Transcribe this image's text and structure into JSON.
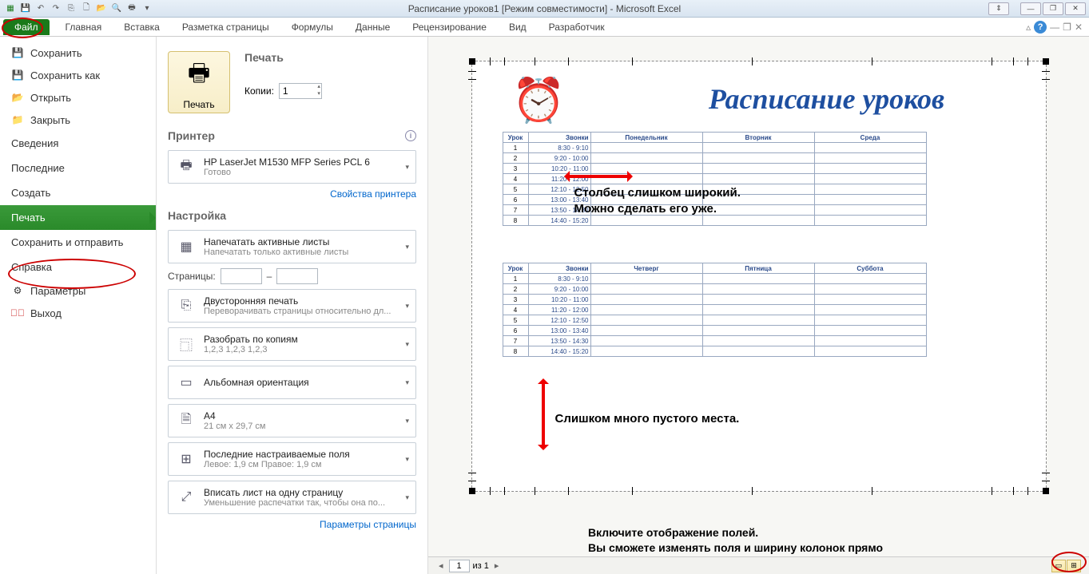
{
  "title": "Расписание уроков1  [Режим совместимости]  -  Microsoft Excel",
  "ribbon": {
    "file": "Файл",
    "tabs": [
      "Главная",
      "Вставка",
      "Разметка страницы",
      "Формулы",
      "Данные",
      "Рецензирование",
      "Вид",
      "Разработчик"
    ]
  },
  "nav": {
    "save": "Сохранить",
    "save_as": "Сохранить как",
    "open": "Открыть",
    "close": "Закрыть",
    "info": "Сведения",
    "recent": "Последние",
    "new": "Создать",
    "print": "Печать",
    "share": "Сохранить и отправить",
    "help": "Справка",
    "options": "Параметры",
    "exit": "Выход"
  },
  "print": {
    "header": "Печать",
    "button": "Печать",
    "copies_label": "Копии:",
    "copies_value": "1",
    "printer_header": "Принтер",
    "printer_name": "HP LaserJet M1530 MFP Series PCL 6",
    "printer_status": "Готово",
    "printer_props": "Свойства принтера",
    "settings_header": "Настройка",
    "pages_label": "Страницы:",
    "pages_sep": "–",
    "s1_main": "Напечатать активные листы",
    "s1_sub": "Напечатать только активные листы",
    "s2_main": "Двусторонняя печать",
    "s2_sub": "Переворачивать страницы относительно дл...",
    "s3_main": "Разобрать по копиям",
    "s3_sub": "1,2,3   1,2,3   1,2,3",
    "s4_main": "Альбомная ориентация",
    "s5_main": "A4",
    "s5_sub": "21 см x 29,7 см",
    "s6_main": "Последние настраиваемые поля",
    "s6_sub": "Левое: 1,9 см   Правое: 1,9 см",
    "s7_main": "Вписать лист на одну страницу",
    "s7_sub": "Уменьшение распечатки так, чтобы она по...",
    "page_setup": "Параметры страницы"
  },
  "preview": {
    "title": "Расписание уроков",
    "headers1": [
      "Урок",
      "Звонки",
      "Понедельник",
      "Вторник",
      "Среда"
    ],
    "headers2": [
      "Урок",
      "Звонки",
      "Четверг",
      "Пятница",
      "Суббота"
    ],
    "rows": [
      {
        "n": "1",
        "t": "8:30 - 9:10"
      },
      {
        "n": "2",
        "t": "9:20 - 10:00"
      },
      {
        "n": "3",
        "t": "10:20 - 11:00"
      },
      {
        "n": "4",
        "t": "11:20 - 12:00"
      },
      {
        "n": "5",
        "t": "12:10 - 12:50"
      },
      {
        "n": "6",
        "t": "13:00 - 13:40"
      },
      {
        "n": "7",
        "t": "13:50 - 14:30"
      },
      {
        "n": "8",
        "t": "14:40 - 15:20"
      }
    ],
    "page_current": "1",
    "page_of": "из 1"
  },
  "anno": {
    "col_wide": "Столбец слишком широкий.\nМожно сделать его уже.",
    "empty": "Слишком много пустого места.",
    "margins": "Включите отображение полей.\nВы сможете изменять поля и ширину колонок прямо\nв окне предварительного просмотра."
  }
}
